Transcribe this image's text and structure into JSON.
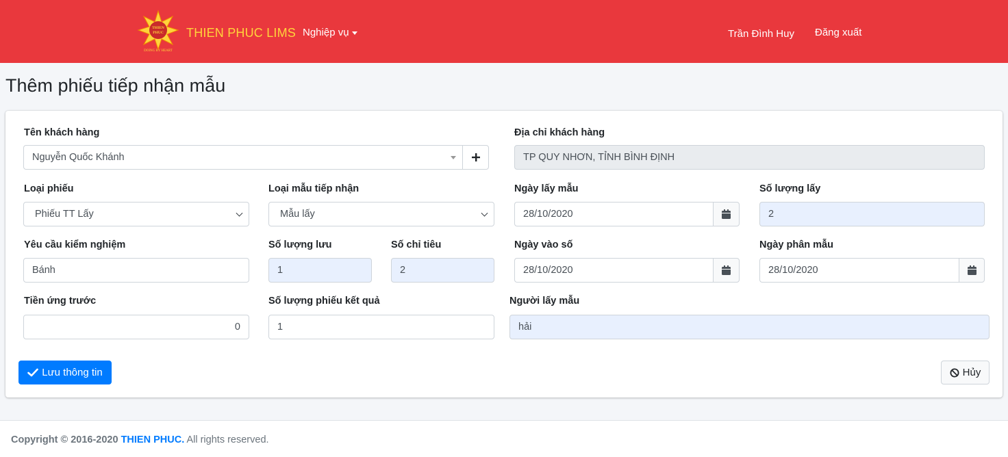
{
  "nav": {
    "brand": "THIEN PHUC LIMS",
    "logo_text_top": "THIEN",
    "logo_text_mid": "PHUC",
    "logo_tagline": "DOING BY HEART",
    "menu_label": "Nghiệp vụ",
    "user_name": "Trần Đình Huy",
    "logout_label": "Đăng xuất"
  },
  "page": {
    "title": "Thêm phiếu tiếp nhận mẫu"
  },
  "form": {
    "customer_name": {
      "label": "Tên khách hàng",
      "value": "Nguyễn Quốc Khánh"
    },
    "customer_address": {
      "label": "Địa chỉ khách hàng",
      "value": "TP QUY NHƠN, TỈNH BÌNH ĐỊNH"
    },
    "ticket_type": {
      "label": "Loại phiếu",
      "value": "Phiếu TT Lấy"
    },
    "sample_type": {
      "label": "Loại mẫu tiếp nhận",
      "value": "Mẫu lấy"
    },
    "sampling_date": {
      "label": "Ngày lấy mẫu",
      "value": "28/10/2020"
    },
    "sample_qty": {
      "label": "Số lượng lấy",
      "value": "2"
    },
    "test_request": {
      "label": "Yêu cầu kiểm nghiệm",
      "value": "Bánh"
    },
    "stored_qty": {
      "label": "Số lượng lưu",
      "value": "1"
    },
    "indicator_count": {
      "label": "Số chỉ tiêu",
      "value": "2"
    },
    "entry_date": {
      "label": "Ngày vào số",
      "value": "28/10/2020"
    },
    "distribution_date": {
      "label": "Ngày phân mẫu",
      "value": "28/10/2020"
    },
    "advance_payment": {
      "label": "Tiền ứng trước",
      "value": "0"
    },
    "result_ticket_qty": {
      "label": "Số lượng phiếu kết quả",
      "value": "1"
    },
    "sampler": {
      "label": "Người lấy mẫu",
      "value": "hải"
    }
  },
  "actions": {
    "save_label": "Lưu thông tin",
    "cancel_label": "Hủy"
  },
  "footer": {
    "prefix": "Copyright © 2016-2020 ",
    "company": "THIEN PHUC.",
    "suffix": " All rights reserved."
  },
  "colors": {
    "navbar": "#e9383d",
    "brand_text": "#ffd43b",
    "primary": "#007bff"
  }
}
